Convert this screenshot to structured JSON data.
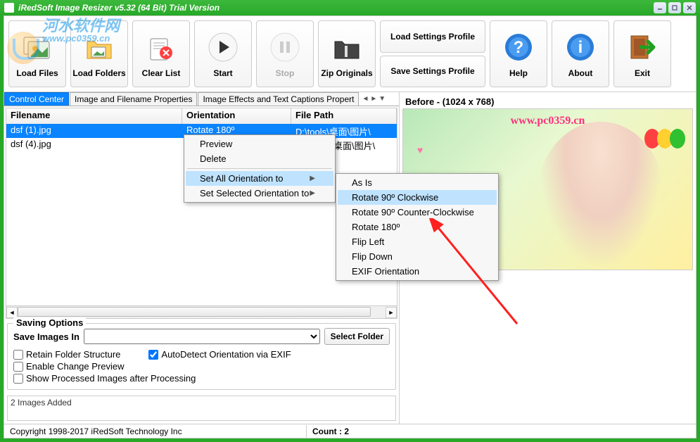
{
  "window": {
    "title": "iRedSoft Image Resizer v5.32 (64 Bit) Trial Version"
  },
  "watermark": {
    "line1": "河水软件网",
    "line2": "www.pc0359.cn"
  },
  "toolbar": {
    "load_files": "Load Files",
    "load_folders": "Load Folders",
    "clear_list": "Clear List",
    "start": "Start",
    "stop": "Stop",
    "zip_originals": "Zip Originals",
    "load_settings": "Load Settings Profile",
    "save_settings": "Save Settings Profile",
    "help": "Help",
    "about": "About",
    "exit": "Exit"
  },
  "tabs": {
    "t0": "Control Center",
    "t1": "Image and Filename Properties",
    "t2": "Image Effects and Text Captions Propert"
  },
  "table": {
    "h_filename": "Filename",
    "h_orientation": "Orientation",
    "h_filepath": "File Path",
    "rows": [
      {
        "filename": "dsf (1).jpg",
        "orientation": "Rotate 180º",
        "path": "D:\\tools\\桌面\\图片\\"
      },
      {
        "filename": "dsf (4).jpg",
        "orientation": "",
        "path": "桌面\\图片\\"
      }
    ]
  },
  "context1": {
    "preview": "Preview",
    "delete": "Delete",
    "set_all": "Set All Orientation to",
    "set_selected": "Set Selected Orientation to"
  },
  "context2": {
    "asis": "As Is",
    "rot90cw": "Rotate 90º Clockwise",
    "rot90ccw": "Rotate 90º Counter-Clockwise",
    "rot180": "Rotate 180º",
    "flipleft": "Flip Left",
    "flipdown": "Flip Down",
    "exif": "EXIF Orientation"
  },
  "saving": {
    "legend": "Saving Options",
    "save_in": "Save Images In",
    "select_folder": "Select Folder",
    "retain": "Retain Folder Structure",
    "enable_preview": "Enable Change Preview",
    "show_after": "Show Processed Images after Processing",
    "autodetect": "AutoDetect Orientation via EXIF"
  },
  "log": {
    "text": "2 Images Added"
  },
  "status": {
    "copyright": "Copyright 1998-2017 iRedSoft Technology Inc",
    "count_label": "Count : 2"
  },
  "preview": {
    "label": "Before - (1024 x 768)",
    "url": "www.pc0359.cn"
  }
}
